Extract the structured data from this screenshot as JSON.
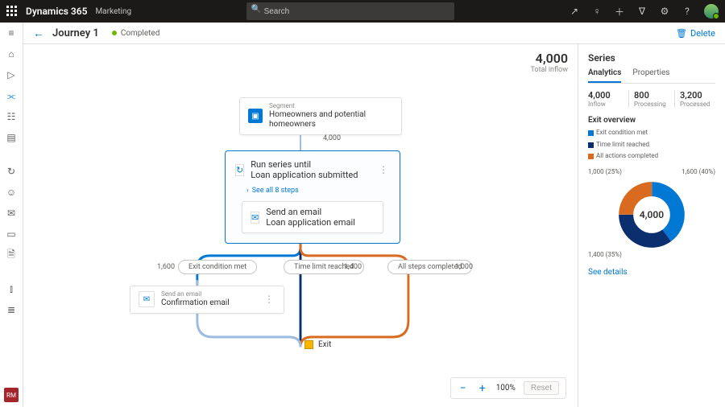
{
  "app": {
    "brand": "Dynamics 365",
    "area": "Marketing",
    "search_placeholder": "Search"
  },
  "header": {
    "title": "Journey 1",
    "status": "Completed",
    "delete": "Delete"
  },
  "inflow": {
    "value": "4,000",
    "label": "Total inflow"
  },
  "segment": {
    "over": "Segment",
    "name": "Homeowners and potential homeowners",
    "count": "4,000"
  },
  "series": {
    "over": "Run series until",
    "name": "Loan application submitted",
    "see_all": "See all 8 steps",
    "inner_over": "Send an email",
    "inner_name": "Loan application email"
  },
  "branches": {
    "left": {
      "pill": "Exit condition met",
      "count": "1,600"
    },
    "mid": {
      "pill": "Time limit reached",
      "count": "1,400"
    },
    "right": {
      "pill": "All steps completed",
      "count": "1,000"
    }
  },
  "confirm": {
    "over": "Send an email",
    "name": "Confirmation email"
  },
  "exit": "Exit",
  "zoom": {
    "value": "100%",
    "reset": "Reset"
  },
  "pane": {
    "title": "Series",
    "tab_analytics": "Analytics",
    "tab_props": "Properties",
    "stats": [
      {
        "v": "4,000",
        "l": "Inflow"
      },
      {
        "v": "800",
        "l": "Processing"
      },
      {
        "v": "3,200",
        "l": "Processed"
      }
    ],
    "overview_title": "Exit overview",
    "legend": {
      "a": "Exit condition met",
      "b": "Time limit reached",
      "c": "All actions completed"
    },
    "callouts": {
      "tl": "1,000 (25%)",
      "tr": "1,600 (40%)",
      "bl": "1,400 (35%)"
    },
    "center": "4,000",
    "details": "See details"
  },
  "chart_data": {
    "type": "pie",
    "title": "Exit overview",
    "series": [
      {
        "name": "Exit condition met",
        "value": 1600,
        "pct": 40,
        "color": "#0078d4"
      },
      {
        "name": "Time limit reached",
        "value": 1400,
        "pct": 35,
        "color": "#0b2e6f"
      },
      {
        "name": "All actions completed",
        "value": 1000,
        "pct": 25,
        "color": "#d86b1f"
      }
    ],
    "total": 4000
  }
}
